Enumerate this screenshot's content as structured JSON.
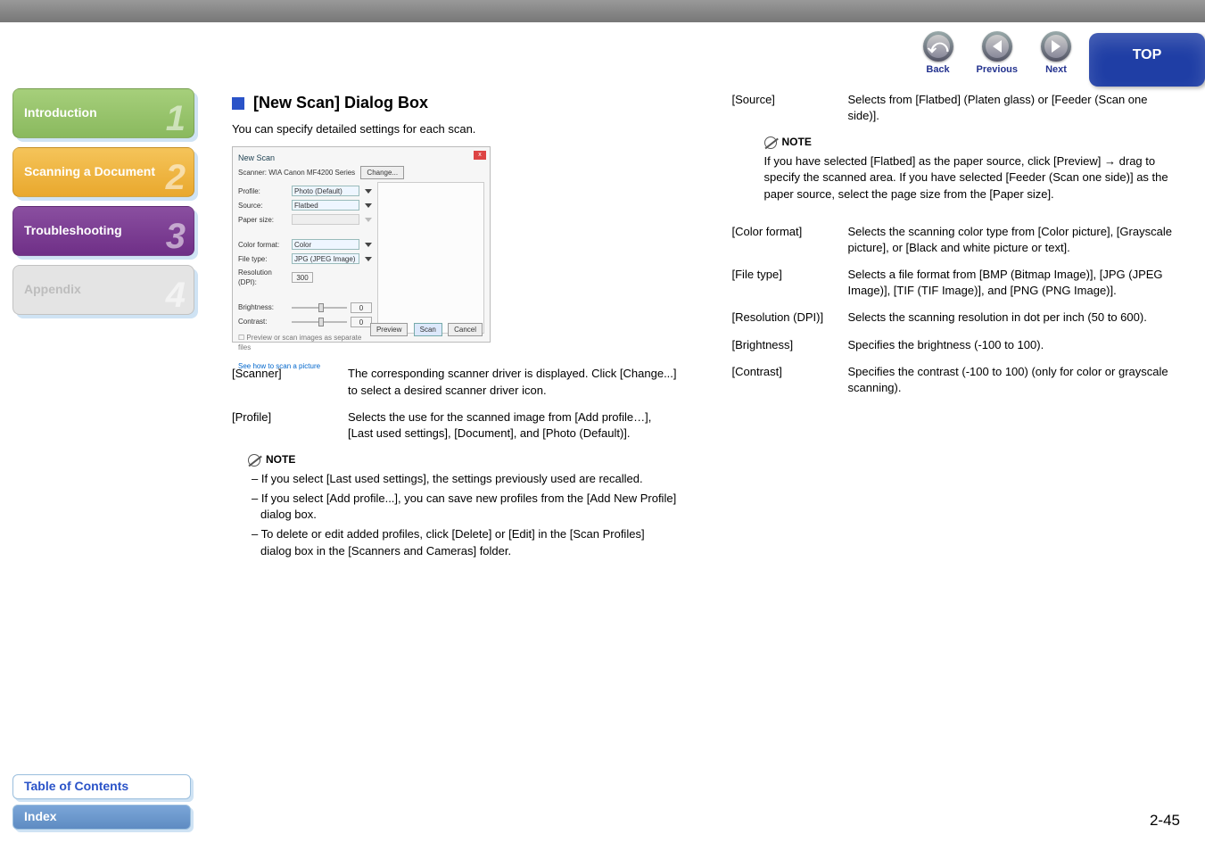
{
  "header": {
    "back": "Back",
    "previous": "Previous",
    "next": "Next",
    "top": "TOP"
  },
  "sidebar": {
    "items": [
      {
        "label": "Introduction",
        "num": "1"
      },
      {
        "label": "Scanning a Document",
        "num": "2"
      },
      {
        "label": "Troubleshooting",
        "num": "3"
      },
      {
        "label": "Appendix",
        "num": "4"
      }
    ]
  },
  "footer": {
    "toc": "Table of Contents",
    "index": "Index"
  },
  "page_number": "2-45",
  "section": {
    "title": "[New Scan] Dialog Box",
    "intro": "You can specify detailed settings for each scan."
  },
  "dialog": {
    "title": "New Scan",
    "close": "x",
    "scanner_line": "Scanner: WIA Canon MF4200 Series",
    "change_btn": "Change...",
    "rows": {
      "profile_label": "Profile:",
      "profile_value": "Photo (Default)",
      "source_label": "Source:",
      "source_value": "Flatbed",
      "papersize_label": "Paper size:",
      "papersize_value": "",
      "colorfmt_label": "Color format:",
      "colorfmt_value": "Color",
      "filetype_label": "File type:",
      "filetype_value": "JPG (JPEG Image)",
      "res_label": "Resolution (DPI):",
      "res_value": "300",
      "bright_label": "Brightness:",
      "bright_value": "0",
      "contrast_label": "Contrast:",
      "contrast_value": "0"
    },
    "checkbox": "Preview or scan images as separate files",
    "help_link": "See how to scan a picture",
    "preview_btn": "Preview",
    "scan_btn": "Scan",
    "cancel_btn": "Cancel"
  },
  "defs_left": {
    "scanner": {
      "k": "[Scanner]",
      "v": "The corresponding scanner driver is displayed. Click [Change...] to select a desired scanner driver icon."
    },
    "profile": {
      "k": "[Profile]",
      "v": "Selects the use for the scanned image from [Add profile…], [Last used settings], [Document], and [Photo (Default)]."
    }
  },
  "note_label": "NOTE",
  "notes_left": [
    "If you select [Last used settings], the settings previously used are recalled.",
    "If you select [Add profile...], you can save new profiles from the [Add New Profile] dialog box.",
    "To delete or edit added profiles, click [Delete] or [Edit] in the [Scan Profiles] dialog box in the [Scanners and Cameras] folder."
  ],
  "defs_right_top": {
    "source": {
      "k": "[Source]",
      "v": "Selects from [Flatbed] (Platen glass) or [Feeder (Scan one side)]."
    }
  },
  "note_right": "If you have selected [Flatbed] as the paper source, click [Preview] → drag to specify the scanned area. If you have selected [Feeder (Scan one side)] as the paper source, select the page size from the [Paper size].",
  "defs_right": {
    "colorfmt": {
      "k": "[Color format]",
      "v": "Selects the scanning color type from [Color picture], [Grayscale picture], or [Black and white picture or text]."
    },
    "filetype": {
      "k": "[File type]",
      "v": "Selects a file format from [BMP (Bitmap Image)], [JPG (JPEG Image)], [TIF (TIF Image)], and [PNG (PNG Image)]."
    },
    "resolution": {
      "k": "[Resolution (DPI)]",
      "v": "Selects the scanning resolution in dot per inch (50 to 600)."
    },
    "brightness": {
      "k": "[Brightness]",
      "v": "Specifies the brightness (-100 to 100)."
    },
    "contrast": {
      "k": "[Contrast]",
      "v": "Specifies the contrast (-100 to 100) (only for color or grayscale scanning)."
    }
  }
}
